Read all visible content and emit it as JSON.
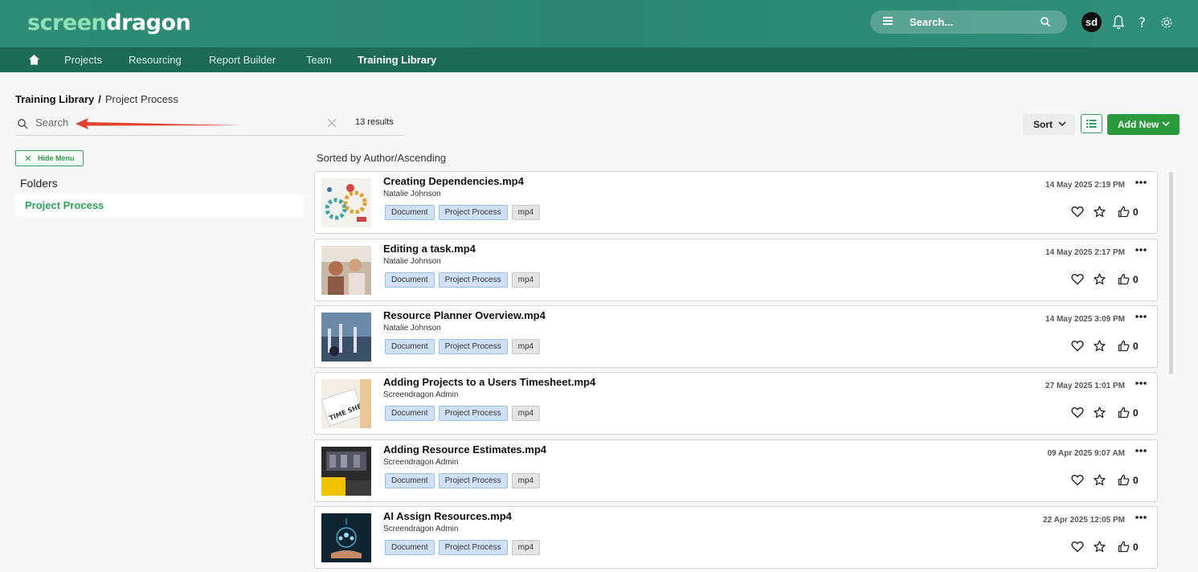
{
  "header": {
    "logo_part1": "screen",
    "logo_part2": "dragon",
    "search_placeholder": "Search...",
    "avatar_initials": "sd"
  },
  "nav": {
    "items": [
      "Projects",
      "Resourcing",
      "Report Builder",
      "Team",
      "Training Library"
    ],
    "active": "Training Library"
  },
  "breadcrumb": {
    "root": "Training Library",
    "separator": "/",
    "current": "Project Process"
  },
  "search": {
    "placeholder": "Search",
    "results": "13 results"
  },
  "toolbar": {
    "sort_label": "Sort",
    "add_new_label": "Add New"
  },
  "sidebar": {
    "hide_menu_label": "Hide Menu",
    "folders_title": "Folders",
    "selected_folder": "Project Process"
  },
  "list": {
    "sorted_by": "Sorted by Author/Ascending",
    "items": [
      {
        "title": "Creating Dependencies.mp4",
        "author": "Natalie Johnson",
        "tags": [
          "Document",
          "Project Process",
          "mp4"
        ],
        "date": "14 May 2025 2:19 PM",
        "likes": "0"
      },
      {
        "title": "Editing a task.mp4",
        "author": "Natalie Johnson",
        "tags": [
          "Document",
          "Project Process",
          "mp4"
        ],
        "date": "14 May 2025 2:17 PM",
        "likes": "0"
      },
      {
        "title": "Resource Planner Overview.mp4",
        "author": "Natalie Johnson",
        "tags": [
          "Document",
          "Project Process",
          "mp4"
        ],
        "date": "14 May 2025 3:09 PM",
        "likes": "0"
      },
      {
        "title": "Adding Projects to a Users Timesheet.mp4",
        "author": "Screendragon Admin",
        "tags": [
          "Document",
          "Project Process",
          "mp4"
        ],
        "date": "27 May 2025 1:01 PM",
        "likes": "0"
      },
      {
        "title": "Adding Resource Estimates.mp4",
        "author": "Screendragon Admin",
        "tags": [
          "Document",
          "Project Process",
          "mp4"
        ],
        "date": "09 Apr 2025 9:07 AM",
        "likes": "0"
      },
      {
        "title": "AI Assign Resources.mp4",
        "author": "Screendragon Admin",
        "tags": [
          "Document",
          "Project Process",
          "mp4"
        ],
        "date": "22 Apr 2025 12:05 PM",
        "likes": "0"
      }
    ]
  },
  "colors": {
    "header": "#2e8c74",
    "nav": "#1e6b55",
    "accent_green": "#2a9a3c",
    "arrow_red": "#e0432f"
  }
}
